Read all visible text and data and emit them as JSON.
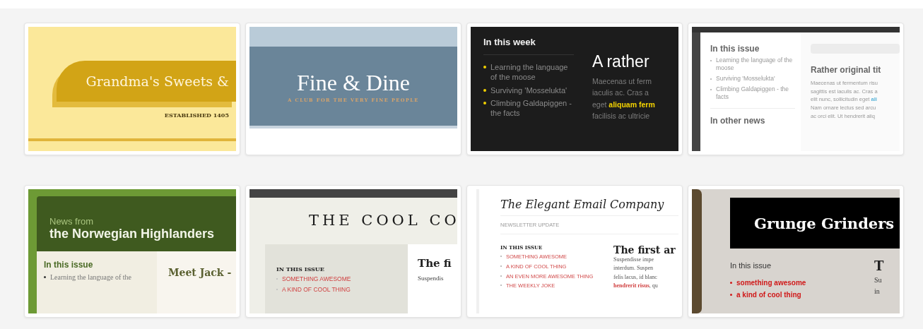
{
  "templates": [
    {
      "kind": "ribbon",
      "title": "Grandma's Sweets &",
      "subtitle": "ESTABLISHED 1405"
    },
    {
      "kind": "banner",
      "title": "Fine & Dine",
      "subtitle": "A CLUB FOR THE VERY FINE PEOPLE"
    },
    {
      "kind": "dark",
      "sidebar_heading": "In this week",
      "sidebar_items": [
        "Learning the language of the moose",
        "Surviving 'Mosselukta'",
        "Climbing Galdapiggen - the facts"
      ],
      "headline": "A rather",
      "body": [
        "Maecenas ut ferm",
        "iaculis ac. Cras a",
        "eget **aliquam ferm**",
        "facilisis ac ultricie"
      ]
    },
    {
      "kind": "light",
      "sidebar_heading": "In this issue",
      "sidebar_items": [
        "Learning the language of the moose",
        "Surviving 'Mosselukta'",
        "Climbing Galdapiggen - the facts"
      ],
      "sidebar_heading_2": "In other news",
      "headline": "Rather original tit",
      "body": [
        "Maecenas ut fermentum risu",
        "sagittis est iaculis ac. Cras a",
        "elit nunc, sollicitudin eget **ali**",
        "Nam ornare lectus sed arcu",
        "ac orci elit. Ut hendrerit aliq"
      ]
    },
    {
      "kind": "green",
      "eyebrow": "News from",
      "title": "the Norwegian Highlanders",
      "sidebar_heading": "In this issue",
      "sidebar_items": [
        "Learning the language of the"
      ],
      "headline": "Meet Jack -"
    },
    {
      "kind": "cool",
      "title": "THE COOL CO",
      "sidebar_heading": "IN THIS ISSUE",
      "sidebar_items": [
        "SOMETHING AWESOME",
        "A KIND OF COOL THING"
      ],
      "headline": "The fi",
      "body": [
        "Suspendis"
      ]
    },
    {
      "kind": "elegant",
      "title": "The Elegant Email Company",
      "tagline": "NEWSLETTER UPDATE",
      "sidebar_heading": "IN THIS ISSUE",
      "sidebar_items": [
        "SOMETHING AWESOME",
        "A KIND OF COOL THING",
        "AN EVEN MORE AWESOME THING",
        "THE WEEKLY JOKE"
      ],
      "headline": "The first ar",
      "body": [
        "Suspendisse impe",
        "interdum. Suspen",
        "felis lacus, id blanc",
        "**hendrerit risus**, qu"
      ]
    },
    {
      "kind": "grunge",
      "title": "Grunge Grinders",
      "sidebar_heading": "In this issue",
      "sidebar_items": [
        "something awesome",
        "a kind of cool thing"
      ],
      "headline": "T",
      "body": [
        "Su",
        "in"
      ]
    }
  ]
}
